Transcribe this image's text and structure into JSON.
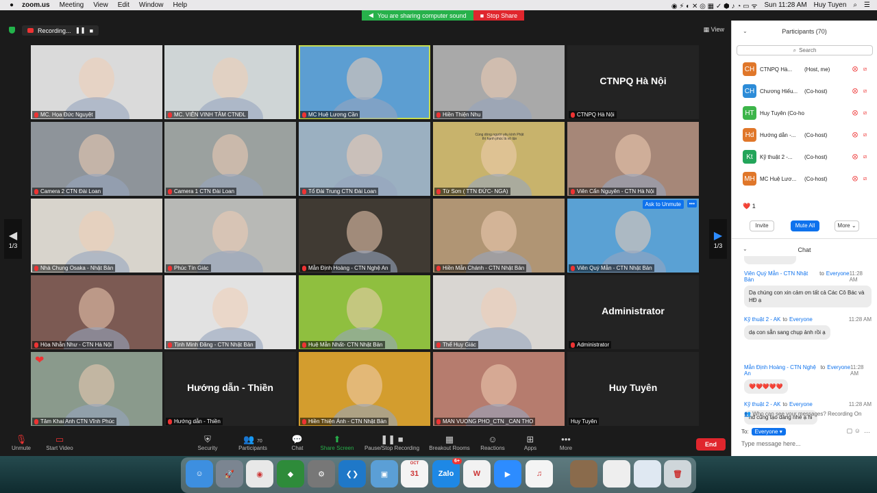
{
  "menubar": {
    "app": "zoom.us",
    "items": [
      "Meeting",
      "View",
      "Edit",
      "Window",
      "Help"
    ],
    "clock": "Sun 11:28 AM",
    "user": "Huy Tuyen"
  },
  "share": {
    "sound": "You are sharing computer sound",
    "stop": "Stop Share"
  },
  "topbar": {
    "recording": "Recording...",
    "view": "View"
  },
  "pages": {
    "left": "1/3",
    "right": "1/3"
  },
  "tiles": [
    {
      "name": "MC. Họa Đức Nguyệt",
      "bg": "#dadada"
    },
    {
      "name": "MC. VIÊN VINH TÂM CTNĐL",
      "bg": "#cfd5d6"
    },
    {
      "name": "MC Huệ Lương Cần",
      "bg": "#5c9ed2",
      "active": true
    },
    {
      "name": "Hiền Thiện Nhu",
      "bg": "#a9a9a9"
    },
    {
      "name": "CTNPQ Hà Nội",
      "big": "CTNPQ Hà Nội",
      "bg": "#232323"
    },
    {
      "name": "Camera 2 CTN Đài Loan",
      "bg": "#8e949a"
    },
    {
      "name": "Camera 1 CTN Đài Loan",
      "bg": "#9ba19f"
    },
    {
      "name": "Tổ Đài Trung  CTN Đài Loan",
      "bg": "#9bb0c1"
    },
    {
      "name": "Từ Sơn ( TTN ĐỨC- NGA)",
      "bg": "#c8b36c",
      "banner": "Cùng dòng người yêu kính Phật thì hạnh phúc là vô tận"
    },
    {
      "name": "Viên Cẩn Nguyên - CTN Hà Nội",
      "bg": "#a68778"
    },
    {
      "name": "Nhà Chung Osaka - Nhật Bản",
      "bg": "#d8d4cc"
    },
    {
      "name": "Phúc Tín Giác",
      "bg": "#b8b9b6"
    },
    {
      "name": "Mẫn Định Hoàng - CTN Nghệ An",
      "bg": "#403a33"
    },
    {
      "name": "Hiền Mẫn Chánh - CTN Nhật Bản",
      "bg": "#b09574"
    },
    {
      "name": "Viên Quý Mẫn - CTN Nhật Bản",
      "bg": "#5aa1d4",
      "ask": "Ask to Unmute"
    },
    {
      "name": "Hòa Nhẫn Như - CTN Hà Nội",
      "bg": "#7c5a53"
    },
    {
      "name": "Tịnh Minh Đăng - CTN Nhật Bản",
      "bg": "#e2e2e2"
    },
    {
      "name": "Huệ Mẫn Nhất- CTN Nhật Bản",
      "bg": "#8fbf3f"
    },
    {
      "name": "Thể Huy Giác",
      "bg": "#d9d6d2"
    },
    {
      "name": "Administrator",
      "big": "Administrator",
      "bg": "#232323"
    },
    {
      "name": "Tâm Khai Anh CTN Vĩnh Phúc",
      "bg": "#8a9a8c",
      "heart": "❤"
    },
    {
      "name": "Hướng dẫn - Thiền",
      "big": "Hướng dẫn - Thiền",
      "bg": "#232323"
    },
    {
      "name": "Hiền Thiện Ánh - CTN Nhật Bản",
      "bg": "#d39d2e"
    },
    {
      "name": "MAN VUONG PHO_CTN _CAN THO",
      "bg": "#b67c6e"
    },
    {
      "name": "Huy Tuyên",
      "big": "Huy Tuyên",
      "bg": "#232323",
      "nomic": true
    }
  ],
  "toolbar": {
    "unmute": "Unmute",
    "start_video": "Start Video",
    "security": "Security",
    "participants": "Participants",
    "participants_count": "70",
    "chat": "Chat",
    "share": "Share Screen",
    "pause": "Pause/Stop Recording",
    "breakout": "Breakout Rooms",
    "reactions": "Reactions",
    "apps": "Apps",
    "more": "More",
    "end": "End"
  },
  "participants": {
    "title": "Participants (70)",
    "search": "Search",
    "list": [
      {
        "initials": "CH",
        "color": "#e0772a",
        "name": "CTNPQ Hà...",
        "role": "(Host, me)"
      },
      {
        "initials": "CH",
        "color": "#2d8cd8",
        "name": "Chương Hiếu...",
        "role": "(Co-host)"
      },
      {
        "initials": "HT",
        "color": "#3db54a",
        "name": "Huy Tuyên (Co-host)",
        "role": ""
      },
      {
        "initials": "Hd",
        "color": "#e0772a",
        "name": "Hướng dẫn -...",
        "role": "(Co-host)"
      },
      {
        "initials": "Kt",
        "color": "#23a55a",
        "name": "Kỹ thuật 2 -...",
        "role": "(Co-host)"
      },
      {
        "initials": "MH",
        "color": "#e0772a",
        "name": "MC Huệ Lươ...",
        "role": "(Co-host)"
      }
    ],
    "reaction": "❤️ 1",
    "invite": "Invite",
    "mute_all": "Mute All",
    "more": "More"
  },
  "chat": {
    "title": "Chat",
    "messages": [
      {
        "from": "Viên Quý Mẫn - CTN Nhật Bản",
        "to": "Everyone",
        "time": "11:28 AM",
        "text": "Dạ chúng con xin cảm ơn tất cả Các Cô Bác và HĐ ạ"
      },
      {
        "from": "Kỹ thuật 2 - AK",
        "to": "Everyone",
        "time": "11:28 AM",
        "text": "dạ con sẵn sang chụp ảnh rồi ạ"
      },
      {
        "from": "Mẫn Định Hoàng - CTN Nghệ An",
        "to": "Everyone",
        "time": "11:28 AM",
        "text": "❤️❤️❤️❤️❤️"
      },
      {
        "from": "Kỹ thuật 2 - AK",
        "to": "Everyone",
        "time": "11:28 AM",
        "text": "hđ cũng tạo dáng nhé ạ hi"
      }
    ],
    "to_word": "to",
    "who_can_see": "Who can see your messages? Recording On",
    "recipient_label": "To:",
    "recipient": "Everyone",
    "placeholder": "Type message here..."
  },
  "dock": {
    "apps": [
      {
        "name": "Finder",
        "color": "#3d8fe0",
        "glyph": "☺"
      },
      {
        "name": "Launchpad",
        "color": "#7b8591",
        "glyph": "🚀"
      },
      {
        "name": "Chrome",
        "color": "#e8e8e8",
        "glyph": "◉"
      },
      {
        "name": "Sourcetree",
        "color": "#2e8b3a",
        "glyph": "◆"
      },
      {
        "name": "System Preferences",
        "color": "#777",
        "glyph": "⚙"
      },
      {
        "name": "VS Code",
        "color": "#1f78c8",
        "glyph": "❮❯"
      },
      {
        "name": "App",
        "color": "#5b9fd6",
        "glyph": "▣"
      },
      {
        "name": "Calendar",
        "color": "#f4f4f4",
        "glyph": "31",
        "month": "OCT"
      },
      {
        "name": "Zalo",
        "color": "#1e88e5",
        "glyph": "Zalo",
        "badge": "6+"
      },
      {
        "name": "WPS",
        "color": "#f2f2f2",
        "glyph": "W"
      },
      {
        "name": "Zoom",
        "color": "#2d8cff",
        "glyph": "▶"
      },
      {
        "name": "iTunes",
        "color": "#f4f4f4",
        "glyph": "♫"
      },
      {
        "name": "Photo",
        "color": "#8a6b4c",
        "glyph": ""
      },
      {
        "name": "Doc",
        "color": "#eeeeee",
        "glyph": ""
      },
      {
        "name": "Window",
        "color": "#dfe8f2",
        "glyph": ""
      },
      {
        "name": "Trash",
        "color": "#cfd6da",
        "glyph": "🗑"
      }
    ]
  }
}
